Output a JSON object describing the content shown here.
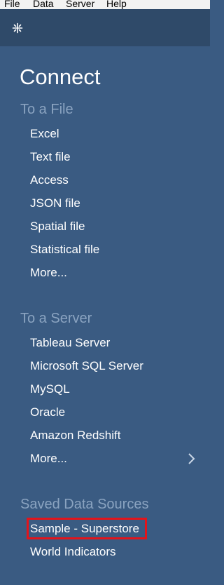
{
  "menubar": {
    "items": [
      "File",
      "Data",
      "Server",
      "Help"
    ]
  },
  "toolbar": {
    "logo_icon": "tableau-logo-icon"
  },
  "connect": {
    "title": "Connect",
    "to_a_file": {
      "label": "To a File",
      "items": [
        "Excel",
        "Text file",
        "Access",
        "JSON file",
        "Spatial file",
        "Statistical file",
        "More..."
      ]
    },
    "to_a_server": {
      "label": "To a Server",
      "items": [
        "Tableau Server",
        "Microsoft SQL Server",
        "MySQL",
        "Oracle",
        "Amazon Redshift",
        "More..."
      ],
      "more_icon": "chevron-right-icon"
    },
    "saved_sources": {
      "label": "Saved Data Sources",
      "items": [
        "Sample - Superstore",
        "World Indicators"
      ],
      "highlighted_index": 0
    }
  },
  "colors": {
    "panel_bg": "#3a5b82",
    "toolbar_bg": "#2f4a69",
    "section_label": "#8aa3c0",
    "highlight_border": "#e3141b"
  }
}
